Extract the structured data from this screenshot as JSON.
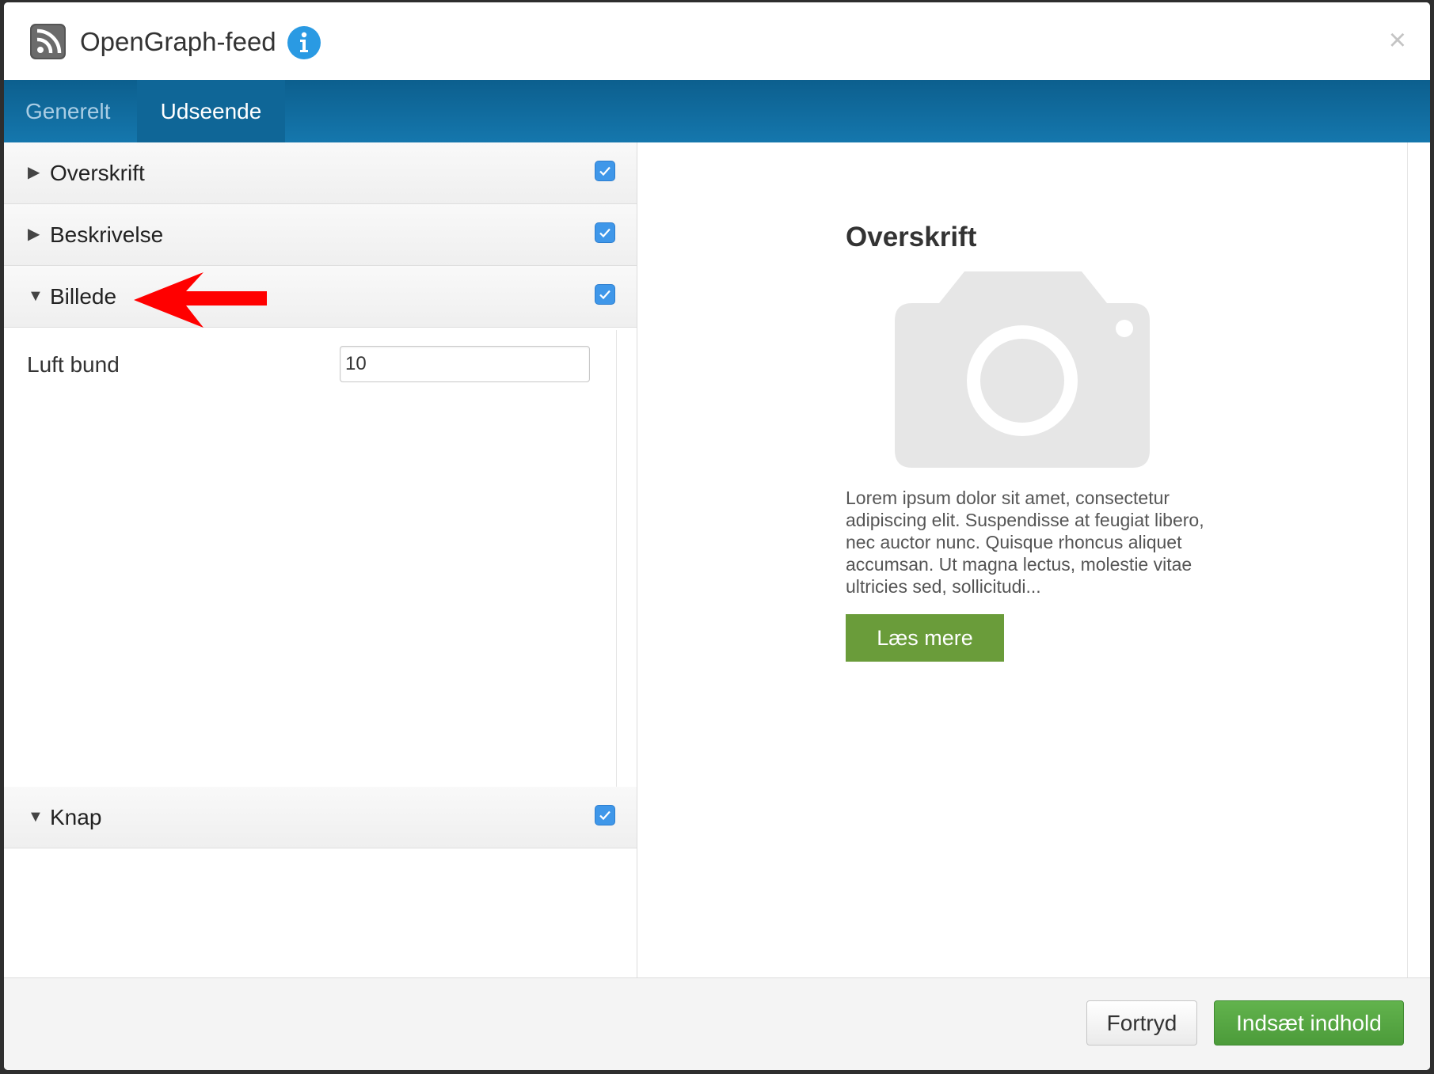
{
  "header": {
    "title": "OpenGraph-feed",
    "rss_icon": "rss-icon",
    "info_icon": "info-icon",
    "close_icon": "close-icon",
    "close_glyph": "×",
    "info_color": "#2a9ae3"
  },
  "tabs": [
    {
      "label": "Generelt",
      "active": false
    },
    {
      "label": "Udseende",
      "active": true
    }
  ],
  "sections": [
    {
      "label": "Overskrift",
      "expanded": false,
      "checked": true
    },
    {
      "label": "Beskrivelse",
      "expanded": false,
      "checked": true
    },
    {
      "label": "Billede",
      "expanded": true,
      "checked": true
    },
    {
      "label": "Knap",
      "expanded": true,
      "checked": true
    }
  ],
  "image_settings": {
    "field_label": "Luft bund",
    "field_value": "10"
  },
  "annotation": {
    "color": "#ff0000",
    "icon": "arrow-left-icon"
  },
  "preview": {
    "title": "Overskrift",
    "image_icon": "camera-icon",
    "description": "Lorem ipsum dolor sit amet, consectetur adipiscing elit. Suspendisse at feugiat libero, nec auctor nunc. Quisque rhoncus aliquet accumsan. Ut magna lectus, molestie vitae ultricies sed, sollicitudi...",
    "button_label": "Læs mere",
    "button_color": "#6a9c3a"
  },
  "footer": {
    "cancel_label": "Fortryd",
    "insert_label": "Indsæt indhold",
    "insert_color": "#54a540"
  }
}
